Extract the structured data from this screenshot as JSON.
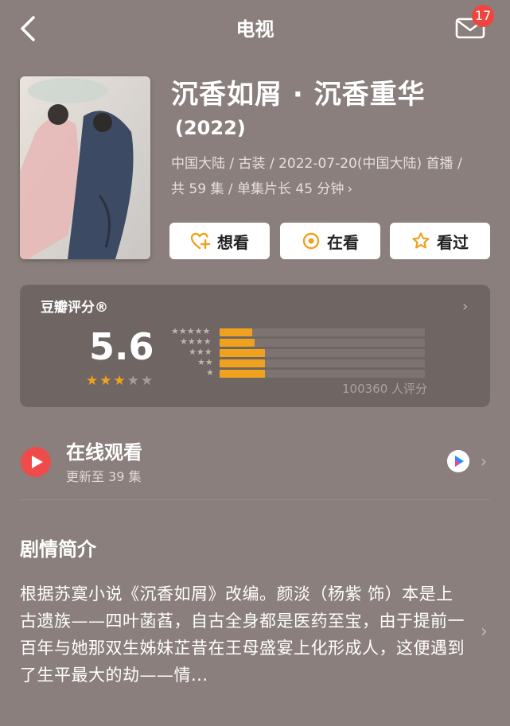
{
  "header": {
    "title": "电视",
    "back_icon": "chevron-left-icon",
    "mail_icon": "mail-icon",
    "mail_badge": "17"
  },
  "show": {
    "title": "沉香如屑 · 沉香重华",
    "year": "(2022)",
    "meta_line1": "中国大陆 / 古装 / 2022-07-20(中国大陆) 首播 /",
    "meta_line2": "共 59 集 / 单集片长 45 分钟",
    "meta_chevron": "›"
  },
  "actions": {
    "want": "想看",
    "watching": "在看",
    "watched": "看过"
  },
  "rating": {
    "label": "豆瓣评分®",
    "chevron": "›",
    "score": "5.6",
    "score_stars": 3,
    "count": "100360 人评分",
    "distribution": [
      {
        "stars": "★★★★★",
        "fraction": 0.16
      },
      {
        "stars": "★★★★",
        "fraction": 0.17
      },
      {
        "stars": "★★★",
        "fraction": 0.22
      },
      {
        "stars": "★★",
        "fraction": 0.22
      },
      {
        "stars": "★",
        "fraction": 0.22
      }
    ]
  },
  "online": {
    "title": "在线观看",
    "subtitle": "更新至 39 集",
    "chevron": "›"
  },
  "synopsis": {
    "title": "剧情简介",
    "text": "根据苏寞小说《沉香如屑》改编。颜淡（杨紫 饰）本是上古遗族——四叶菡萏，自古全身都是医药至宝，由于提前一百年与她那双生姊妹芷昔在王母盛宴上化形成人，这便遇到了生平最大的劫——情...",
    "chevron": "›"
  },
  "colors": {
    "background": "#8a7f7c",
    "card": "#6f6663",
    "accent_orange": "#f0a21f",
    "badge_red": "#f0443f",
    "play_red": "#f04b4b"
  }
}
